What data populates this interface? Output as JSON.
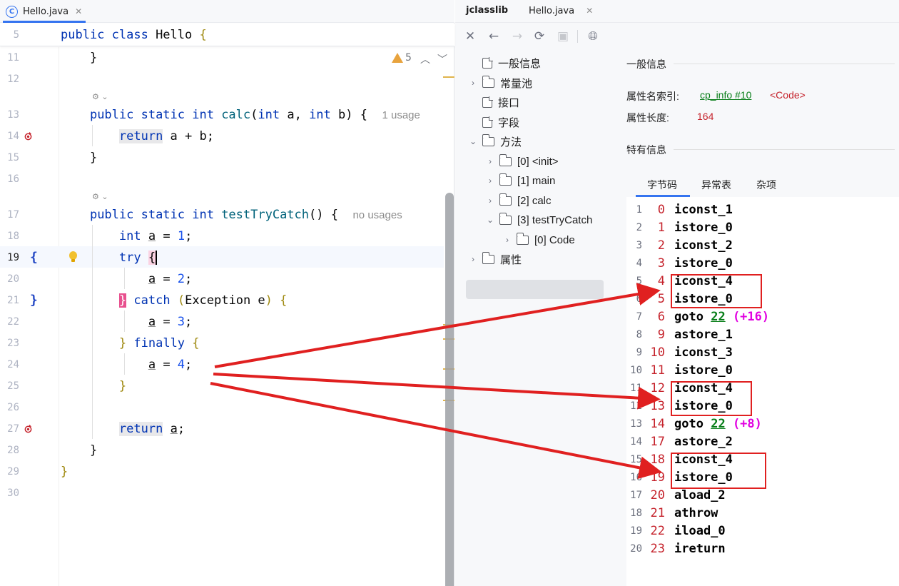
{
  "editor": {
    "tab_label": "Hello.java",
    "sticky": {
      "line_number": "5",
      "code": "public class Hello {"
    },
    "warnings_count": "5",
    "lines": [
      {
        "n": "11"
      },
      {
        "n": "12"
      },
      {
        "n": "13"
      },
      {
        "n": "14"
      },
      {
        "n": "15"
      },
      {
        "n": "16"
      },
      {
        "n": "17"
      },
      {
        "n": "18"
      },
      {
        "n": "19"
      },
      {
        "n": "20"
      },
      {
        "n": "21"
      },
      {
        "n": "22"
      },
      {
        "n": "23"
      },
      {
        "n": "24"
      },
      {
        "n": "25"
      },
      {
        "n": "26"
      },
      {
        "n": "27"
      },
      {
        "n": "28"
      },
      {
        "n": "29"
      },
      {
        "n": "30"
      }
    ],
    "calc_usage_hint": "1 usage",
    "testTryCatch_usage_hint": "no usages",
    "gutter_open_brace": "{",
    "gutter_close_brace": "}"
  },
  "jclasslib": {
    "title": "jclasslib",
    "tab_label": "Hello.java",
    "tree": [
      {
        "label": "一般信息",
        "kind": "file"
      },
      {
        "label": "常量池",
        "kind": "folder"
      },
      {
        "label": "接口",
        "kind": "file"
      },
      {
        "label": "字段",
        "kind": "file"
      },
      {
        "label": "方法",
        "kind": "folder"
      },
      {
        "label": "[0] <init>",
        "kind": "folder"
      },
      {
        "label": "[1] main",
        "kind": "folder"
      },
      {
        "label": "[2] calc",
        "kind": "folder"
      },
      {
        "label": "[3] testTryCatch",
        "kind": "folder"
      },
      {
        "label": "[0] Code",
        "kind": "folder"
      },
      {
        "label": "属性",
        "kind": "folder"
      }
    ],
    "general_info_heading": "一般信息",
    "attr_name_index_label": "属性名索引:",
    "attr_name_index_link": "cp_info #10",
    "attr_name_index_value": "<Code>",
    "attr_length_label": "属性长度:",
    "attr_length_value": "164",
    "specific_info_heading": "特有信息",
    "bottom_tabs": [
      "字节码",
      "异常表",
      "杂项"
    ],
    "bytecode": [
      {
        "idx": "1",
        "off": "0",
        "op": "iconst_1"
      },
      {
        "idx": "2",
        "off": "1",
        "op": "istore_0"
      },
      {
        "idx": "3",
        "off": "2",
        "op": "iconst_2"
      },
      {
        "idx": "4",
        "off": "3",
        "op": "istore_0"
      },
      {
        "idx": "5",
        "off": "4",
        "op": "iconst_4"
      },
      {
        "idx": "6",
        "off": "5",
        "op": "istore_0"
      },
      {
        "idx": "7",
        "off": "6",
        "op": "goto",
        "target": "22",
        "rel": "(+16)"
      },
      {
        "idx": "8",
        "off": "9",
        "op": "astore_1"
      },
      {
        "idx": "9",
        "off": "10",
        "op": "iconst_3"
      },
      {
        "idx": "10",
        "off": "11",
        "op": "istore_0"
      },
      {
        "idx": "11",
        "off": "12",
        "op": "iconst_4"
      },
      {
        "idx": "12",
        "off": "13",
        "op": "istore_0"
      },
      {
        "idx": "13",
        "off": "14",
        "op": "goto",
        "target": "22",
        "rel": "(+8)"
      },
      {
        "idx": "14",
        "off": "17",
        "op": "astore_2"
      },
      {
        "idx": "15",
        "off": "18",
        "op": "iconst_4"
      },
      {
        "idx": "16",
        "off": "19",
        "op": "istore_0"
      },
      {
        "idx": "17",
        "off": "20",
        "op": "aload_2"
      },
      {
        "idx": "18",
        "off": "21",
        "op": "athrow"
      },
      {
        "idx": "19",
        "off": "22",
        "op": "iload_0"
      },
      {
        "idx": "20",
        "off": "23",
        "op": "ireturn"
      }
    ]
  },
  "colors": {
    "keyword": "#0033b3",
    "method": "#00627a",
    "number": "#1750eb",
    "bytecode_offset": "#c5222b",
    "branch_target": "#067d17",
    "relative_offset": "#e100e1",
    "annotation_red": "#e02020",
    "accent_blue": "#3574f0"
  }
}
